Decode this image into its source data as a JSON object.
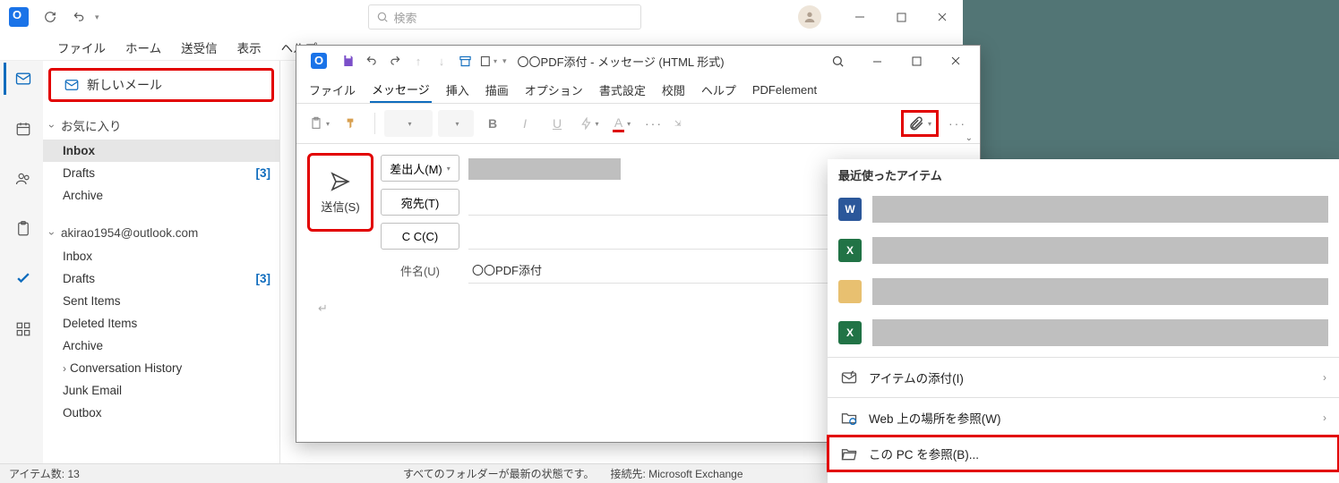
{
  "outlook": {
    "search_placeholder": "検索",
    "menubar": [
      "ファイル",
      "ホーム",
      "送受信",
      "表示",
      "ヘルプ"
    ],
    "newmail_label": "新しいメール",
    "favorites_head": "お気に入り",
    "favorites": [
      {
        "name": "Inbox",
        "count": ""
      },
      {
        "name": "Drafts",
        "count": "[3]"
      },
      {
        "name": "Archive",
        "count": ""
      }
    ],
    "account_head": "akirao1954@outlook.com",
    "folders": [
      {
        "name": "Inbox",
        "count": ""
      },
      {
        "name": "Drafts",
        "count": "[3]"
      },
      {
        "name": "Sent Items",
        "count": ""
      },
      {
        "name": "Deleted Items",
        "count": ""
      },
      {
        "name": "Archive",
        "count": ""
      },
      {
        "name": "Conversation History",
        "count": "",
        "expandable": true
      },
      {
        "name": "Junk Email",
        "count": ""
      },
      {
        "name": "Outbox",
        "count": ""
      }
    ],
    "status_items": "アイテム数: 13",
    "status_mid": "すべてのフォルダーが最新の状態です。　　接続先: Microsoft Exchange"
  },
  "compose": {
    "window_title": "〇〇PDF添付  -  メッセージ (HTML 形式)",
    "ribbon_tabs": [
      "ファイル",
      "メッセージ",
      "挿入",
      "描画",
      "オプション",
      "書式設定",
      "校閲",
      "ヘルプ",
      "PDFelement"
    ],
    "active_tab": 1,
    "send_label": "送信(S)",
    "from_label": "差出人(M)",
    "to_label": "宛先(T)",
    "cc_label": "C C(C)",
    "subject_label": "件名(U)",
    "subject_value": "〇〇PDF添付",
    "body_marker": "↵"
  },
  "attach": {
    "recent_head": "最近使ったアイテム",
    "recent_files": [
      {
        "type": "word"
      },
      {
        "type": "excel"
      },
      {
        "type": "generic"
      },
      {
        "type": "excel"
      }
    ],
    "opt_attach_item": "アイテムの添付(I)",
    "opt_web": "Web 上の場所を参照(W)",
    "opt_pc": "この PC を参照(B)..."
  }
}
